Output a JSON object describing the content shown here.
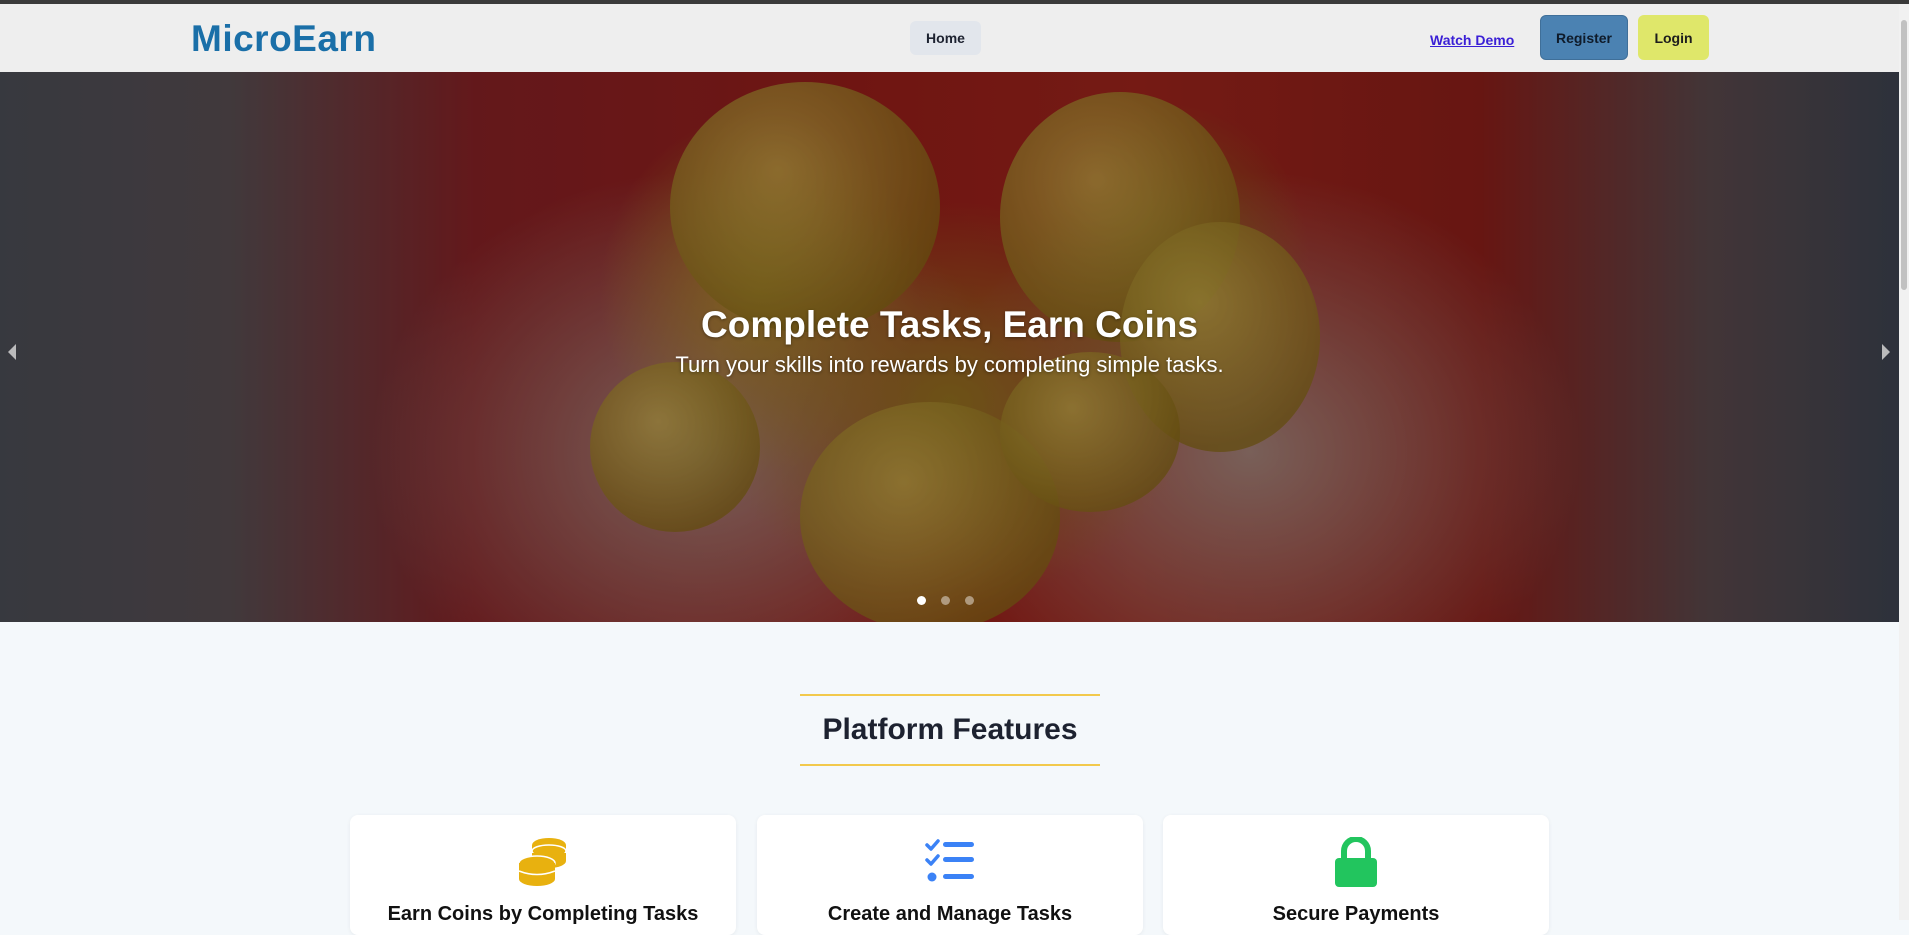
{
  "header": {
    "brand": "MicroEarn",
    "nav_home": "Home",
    "watch_demo": "Watch Demo",
    "register": "Register",
    "login": "Login"
  },
  "hero": {
    "title": "Complete Tasks, Earn Coins",
    "subtitle": "Turn your skills into rewards by completing simple tasks.",
    "slides_total": 3,
    "active_slide": 1
  },
  "features": {
    "heading": "Platform Features",
    "items": [
      {
        "title": "Earn Coins by Completing Tasks",
        "icon": "coins-icon",
        "color": "#e8b10f"
      },
      {
        "title": "Create and Manage Tasks",
        "icon": "task-list-icon",
        "color": "#3b82f6"
      },
      {
        "title": "Secure Payments",
        "icon": "lock-icon",
        "color": "#22c55e"
      }
    ]
  },
  "colors": {
    "brand": "#1a6fa8",
    "register_bg": "#4b82b2",
    "login_bg": "#dfe76a",
    "accent_line": "#f2c94c"
  }
}
